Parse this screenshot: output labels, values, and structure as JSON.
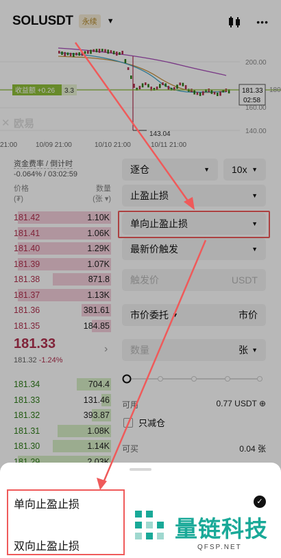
{
  "header": {
    "symbol": "SOLUSDT",
    "badge": "永续",
    "caret": "▼",
    "chart_icon": "candlestick-icon",
    "more_icon": "more-icon",
    "more_glyph": "•••"
  },
  "chart": {
    "price_labels": [
      "200.00",
      "180.00",
      "160.00",
      "140.00"
    ],
    "current_price": "181.33",
    "countdown": "02:58",
    "pnl_label": "收益额 +0.26",
    "pnl_value": "3.3",
    "low_label": "143.04",
    "brand": "欧易",
    "time_labels": [
      "21:00",
      "10/09 21:00",
      "10/10 21:00",
      "10/11 21:00"
    ],
    "colors": {
      "up": "#2f7d19",
      "down": "#b2314f",
      "ma1": "#a64ab8",
      "ma2": "#c78f3a",
      "ma3": "#3aa3c7",
      "price_line": "#8fbf3a"
    }
  },
  "funding": {
    "label": "资金费率 / 倒计时",
    "value": "-0.064% / 03:02:59"
  },
  "orderbook": {
    "price_header": "价格",
    "price_unit": "(₮)",
    "qty_header": "数量",
    "qty_unit": "(张 ▾)",
    "asks": [
      {
        "price": "181.42",
        "qty": "1.10K",
        "depth": 0.96
      },
      {
        "price": "181.41",
        "qty": "1.06K",
        "depth": 0.96
      },
      {
        "price": "181.40",
        "qty": "1.29K",
        "depth": 0.96
      },
      {
        "price": "181.39",
        "qty": "1.07K",
        "depth": 0.96
      },
      {
        "price": "181.38",
        "qty": "871.8",
        "depth": 0.6
      },
      {
        "price": "181.37",
        "qty": "1.13K",
        "depth": 0.96
      },
      {
        "price": "181.36",
        "qty": "381.61",
        "depth": 0.3
      },
      {
        "price": "181.35",
        "qty": "184.85",
        "depth": 0.2
      }
    ],
    "last_price": "181.33",
    "mark_price": "181.32",
    "change": "-1.24%",
    "bids": [
      {
        "price": "181.34",
        "qty": "704.4",
        "depth": 0.35
      },
      {
        "price": "181.33",
        "qty": "131.46",
        "depth": 0.1
      },
      {
        "price": "181.32",
        "qty": "393.87",
        "depth": 0.2
      },
      {
        "price": "181.31",
        "qty": "1.08K",
        "depth": 0.55
      },
      {
        "price": "181.30",
        "qty": "1.14K",
        "depth": 0.6
      },
      {
        "price": "181.29",
        "qty": "2.03K",
        "depth": 0.96
      }
    ]
  },
  "form": {
    "margin_mode": "逐仓",
    "leverage": "10x",
    "order_type": "止盈止损",
    "tpsl_mode": "单向止盈止损",
    "trigger_type": "最新价触发",
    "trigger_placeholder": "触发价",
    "trigger_unit": "USDT",
    "exec_type": "市价委托",
    "exec_value": "市价",
    "qty_placeholder": "数量",
    "qty_unit": "张",
    "available_label": "可用",
    "available_value": "0.77 USDT ⊕",
    "reduce_only": "只减仓",
    "can_buy_label": "可买",
    "can_buy_value": "0.04 张"
  },
  "sheet": {
    "options": [
      "单向止盈止损",
      "双向止盈止损"
    ],
    "selected_index": 0,
    "check_glyph": "✓"
  },
  "watermark": {
    "text": "量链科技",
    "url": "QFSP.NET"
  }
}
